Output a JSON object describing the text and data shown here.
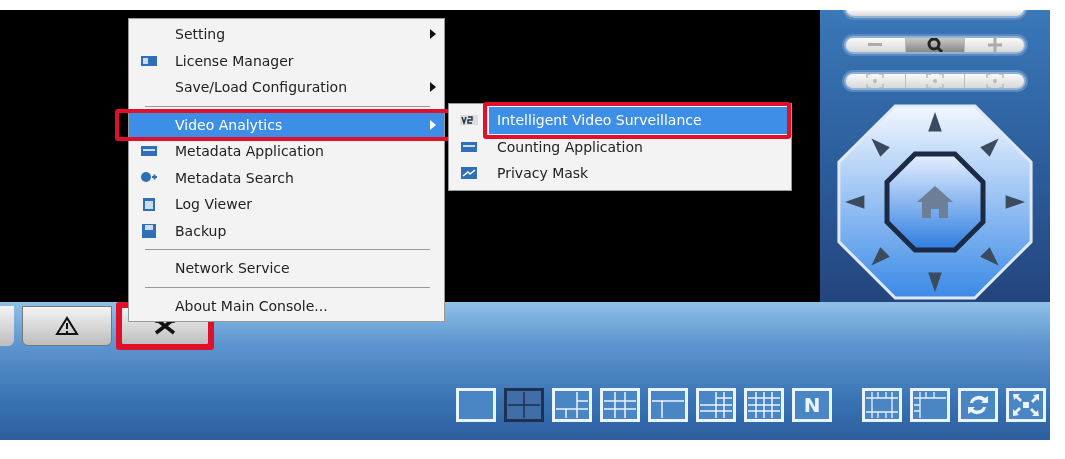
{
  "menu": {
    "items": [
      {
        "kind": "item",
        "label": "Setting",
        "icon": false,
        "submenu": true,
        "selected": false,
        "highlighted": false
      },
      {
        "kind": "item",
        "label": "License Manager",
        "icon": true,
        "submenu": false,
        "selected": false,
        "highlighted": false
      },
      {
        "kind": "item",
        "label": "Save/Load Configuration",
        "icon": false,
        "submenu": true,
        "selected": false,
        "highlighted": false
      },
      {
        "kind": "separator"
      },
      {
        "kind": "item",
        "label": "Video Analytics",
        "icon": false,
        "submenu": true,
        "selected": true,
        "highlighted": true
      },
      {
        "kind": "item",
        "label": "Metadata Application",
        "icon": true,
        "submenu": false,
        "selected": false,
        "highlighted": false
      },
      {
        "kind": "item",
        "label": "Metadata Search",
        "icon": true,
        "submenu": false,
        "selected": false,
        "highlighted": false
      },
      {
        "kind": "item",
        "label": "Log Viewer",
        "icon": true,
        "submenu": false,
        "selected": false,
        "highlighted": false
      },
      {
        "kind": "item",
        "label": "Backup",
        "icon": true,
        "submenu": false,
        "selected": false,
        "highlighted": false
      },
      {
        "kind": "separator"
      },
      {
        "kind": "item",
        "label": "Network Service",
        "icon": false,
        "submenu": false,
        "selected": false,
        "highlighted": false
      },
      {
        "kind": "separator"
      },
      {
        "kind": "item",
        "label": "About Main Console...",
        "icon": false,
        "submenu": false,
        "selected": false,
        "highlighted": false
      }
    ]
  },
  "submenu": {
    "items": [
      {
        "label": "Intelligent Video Surveillance",
        "selected": true,
        "highlighted": true
      },
      {
        "label": "Counting Application",
        "selected": false,
        "highlighted": false
      },
      {
        "label": "Privacy Mask",
        "selected": false,
        "highlighted": false
      }
    ]
  },
  "tabs": [
    {
      "kind": "alert",
      "highlighted": false
    },
    {
      "kind": "tools",
      "highlighted": true
    }
  ],
  "layout_buttons": [
    {
      "kind": "single",
      "selected": false
    },
    {
      "kind": "quad",
      "selected": true
    },
    {
      "kind": "six",
      "selected": false
    },
    {
      "kind": "nine",
      "selected": false
    },
    {
      "kind": "wide",
      "selected": false
    },
    {
      "kind": "eight",
      "selected": false
    },
    {
      "kind": "sixteen",
      "selected": false
    },
    {
      "kind": "custom",
      "label": "N",
      "selected": false
    }
  ],
  "view_buttons": [
    {
      "kind": "border"
    },
    {
      "kind": "frame"
    },
    {
      "kind": "rotate"
    },
    {
      "kind": "fullscreen"
    }
  ]
}
